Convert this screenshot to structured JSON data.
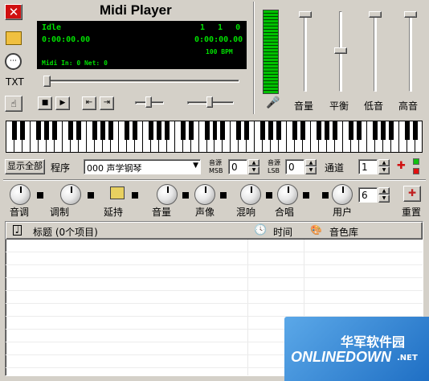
{
  "title": "Midi Player",
  "lcd": {
    "status": "Idle",
    "pos_left": "1 1 0",
    "time_left": "0:00:00.00",
    "time_right": "0:00:00.00",
    "bpm": "100 BPM",
    "midi_info": "Midi In: 0 Net: 0"
  },
  "sidebar": {
    "txt": "TXT"
  },
  "mixer": {
    "labels": [
      "音量",
      "平衡",
      "低音",
      "高音"
    ],
    "levels": [
      1.0,
      0.5,
      1.0,
      1.0
    ]
  },
  "controls": {
    "show_all": "显示全部",
    "program_label": "程序",
    "program_value": "000 声学钢琴",
    "msb_label_top": "音源",
    "msb_label": "MSB",
    "msb_value": "0",
    "lsb_label_top": "音源",
    "lsb_label": "LSB",
    "lsb_value": "0",
    "channel_label": "通道",
    "channel_value": "1",
    "user_value": "6"
  },
  "knobs": [
    "音调",
    "调制",
    "延持",
    "音量",
    "声像",
    "混响",
    "合唱",
    "用户",
    "重置"
  ],
  "table": {
    "col_title": "标题 (0个项目)",
    "col_time": "时间",
    "col_bank": "音色库"
  },
  "watermark": {
    "cn": "华军软件园",
    "en": "ONLINEDOWN",
    "net": ".NET"
  },
  "colors": {
    "lcd_text": "#00e000",
    "lcd_bg": "#000000",
    "close_red": "#d01010",
    "watermark_blue": "#1f6fc4"
  }
}
